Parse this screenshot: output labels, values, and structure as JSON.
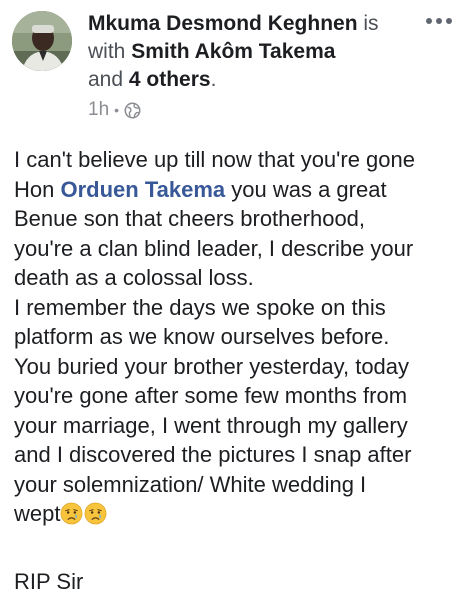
{
  "post": {
    "author": "Mkuma Desmond Keghnen",
    "connector_is": "is",
    "connector_with": "with",
    "tagged_person": "Smith Akôm Takema",
    "connector_and": "and",
    "others": "4 others",
    "period": ".",
    "time": "1h",
    "separator": "•",
    "privacy_icon": "globe-icon",
    "more_icon": "more-horizontal-icon",
    "body": {
      "l1": "I can't believe up till now that you're gone",
      "l2_prefix": "Hon ",
      "mention": "Orduen Takema",
      "l2_suffix": " you was a great",
      "l3": "Benue son that cheers brotherhood,",
      "l4": "you're a clan blind leader, I describe your",
      "l5": "death as a colossal loss.",
      "l6": "I remember the days we spoke on this",
      "l7": "platform as we know ourselves before.",
      "l8": "You buried your brother yesterday, today",
      "l9": "you're gone after some few months from",
      "l10": "your marriage, I went through my gallery",
      "l11": "and I discovered the pictures I snap after",
      "l12": "your solemnization/ White wedding I",
      "l13": "wept",
      "emoji": "crying-face-emoji"
    },
    "closing": "RIP Sir"
  },
  "colors": {
    "mention": "#385898",
    "text": "#1c1e21",
    "meta": "#8a8d91"
  }
}
